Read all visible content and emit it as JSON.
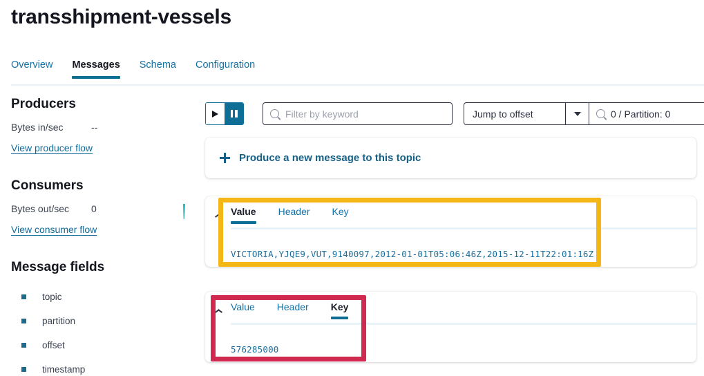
{
  "header": {
    "title": "transshipment-vessels"
  },
  "tabs": [
    {
      "label": "Overview",
      "active": false
    },
    {
      "label": "Messages",
      "active": true
    },
    {
      "label": "Schema",
      "active": false
    },
    {
      "label": "Configuration",
      "active": false
    }
  ],
  "sidebar": {
    "producers": {
      "heading": "Producers",
      "stat_label": "Bytes in/sec",
      "stat_value": "--",
      "link": "View producer flow"
    },
    "consumers": {
      "heading": "Consumers",
      "stat_label": "Bytes out/sec",
      "stat_value": "0",
      "link": "View consumer flow"
    },
    "message_fields": {
      "heading": "Message fields",
      "items": [
        "topic",
        "partition",
        "offset",
        "timestamp"
      ]
    }
  },
  "toolbar": {
    "play_icon": "play-icon",
    "pause_icon": "pause-icon",
    "filter_placeholder": "Filter by keyword",
    "filter_value": "",
    "search_icon": "search-icon",
    "offset_mode": "Jump to offset",
    "offset_caret_icon": "chevron-down-icon",
    "offset_value": "0 / Partition: 0",
    "offset_search_icon": "search-icon"
  },
  "produce": {
    "plus_icon": "plus-icon",
    "label": "Produce a new message to this topic"
  },
  "messages": [
    {
      "collapse_icon": "chevron-up-icon",
      "tabs": [
        {
          "label": "Value",
          "active": true
        },
        {
          "label": "Header",
          "active": false
        },
        {
          "label": "Key",
          "active": false
        }
      ],
      "body": "VICTORIA,YJQE9,VUT,9140097,2012-01-01T05:06:46Z,2015-12-11T22:01:16Z"
    },
    {
      "collapse_icon": "chevron-up-icon",
      "tabs": [
        {
          "label": "Value",
          "active": false
        },
        {
          "label": "Header",
          "active": false
        },
        {
          "label": "Key",
          "active": true
        }
      ],
      "body": "576285000"
    }
  ],
  "annotations": [
    {
      "name": "highlight-value-tab-card",
      "color": "#f5b716"
    },
    {
      "name": "highlight-key-tab-card",
      "color": "#d12a51"
    }
  ],
  "colors": {
    "accent_teal": "#0d6e94",
    "link_blue": "#1271a6",
    "text_dark": "#14161f",
    "highlight_yellow": "#f5b716",
    "highlight_red": "#d12a51",
    "mono_blue": "#1a6e9e"
  }
}
